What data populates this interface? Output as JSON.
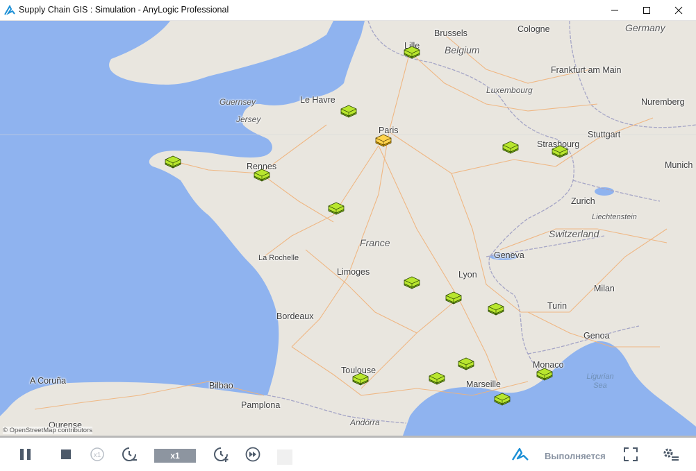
{
  "window": {
    "title": "Supply Chain GIS : Simulation - AnyLogic Professional",
    "app_icon": "anylogic-logo-icon",
    "controls": [
      "minimize-icon",
      "maximize-icon",
      "close-icon"
    ]
  },
  "map": {
    "attribution": "© OpenStreetMap contributors",
    "colors": {
      "land": "#e9e6df",
      "water": "#8fb3ef",
      "roads": "#f0b27a",
      "borders": "#a5a5c6"
    },
    "labels": [
      {
        "text": "Lille",
        "kind": "city"
      },
      {
        "text": "Brussels",
        "kind": "city"
      },
      {
        "text": "Cologne",
        "kind": "city"
      },
      {
        "text": "Germany",
        "kind": "country"
      },
      {
        "text": "Belgium",
        "kind": "country"
      },
      {
        "text": "Frankfurt am Main",
        "kind": "city"
      },
      {
        "text": "Luxembourg",
        "kind": "country"
      },
      {
        "text": "Nuremberg",
        "kind": "city"
      },
      {
        "text": "Le Havre",
        "kind": "city"
      },
      {
        "text": "Guernsey",
        "kind": "region"
      },
      {
        "text": "Jersey",
        "kind": "region"
      },
      {
        "text": "Paris",
        "kind": "city"
      },
      {
        "text": "Strasbourg",
        "kind": "city"
      },
      {
        "text": "Stuttgart",
        "kind": "city"
      },
      {
        "text": "Munich",
        "kind": "city"
      },
      {
        "text": "Rennes",
        "kind": "city"
      },
      {
        "text": "Zurich",
        "kind": "city"
      },
      {
        "text": "Liechtenstein",
        "kind": "region"
      },
      {
        "text": "Switzerland",
        "kind": "country"
      },
      {
        "text": "France",
        "kind": "country"
      },
      {
        "text": "La Rochelle",
        "kind": "city"
      },
      {
        "text": "Geneva",
        "kind": "city"
      },
      {
        "text": "Limoges",
        "kind": "city"
      },
      {
        "text": "Lyon",
        "kind": "city"
      },
      {
        "text": "Milan",
        "kind": "city"
      },
      {
        "text": "Bordeaux",
        "kind": "city"
      },
      {
        "text": "Turin",
        "kind": "city"
      },
      {
        "text": "Genoa",
        "kind": "city"
      },
      {
        "text": "Toulouse",
        "kind": "city"
      },
      {
        "text": "Monaco",
        "kind": "city"
      },
      {
        "text": "A Coruña",
        "kind": "city"
      },
      {
        "text": "Bilbao",
        "kind": "city"
      },
      {
        "text": "Marseille",
        "kind": "city"
      },
      {
        "text": "Ligurian Sea",
        "kind": "sea"
      },
      {
        "text": "Pamplona",
        "kind": "city"
      },
      {
        "text": "Ourense",
        "kind": "city"
      },
      {
        "text": "Andorra",
        "kind": "region"
      }
    ],
    "markers": [
      {
        "name": "warehouse-marker-lille",
        "color": "green"
      },
      {
        "name": "warehouse-marker-le-havre",
        "color": "green"
      },
      {
        "name": "warehouse-marker-paris",
        "color": "yellow"
      },
      {
        "name": "warehouse-marker-brest",
        "color": "green"
      },
      {
        "name": "warehouse-marker-rennes",
        "color": "green"
      },
      {
        "name": "warehouse-marker-metz",
        "color": "green"
      },
      {
        "name": "warehouse-marker-strasbourg",
        "color": "green"
      },
      {
        "name": "warehouse-marker-tours",
        "color": "green"
      },
      {
        "name": "warehouse-marker-clermont",
        "color": "green"
      },
      {
        "name": "warehouse-marker-lyon",
        "color": "green"
      },
      {
        "name": "warehouse-marker-grenoble",
        "color": "green"
      },
      {
        "name": "warehouse-marker-nimes",
        "color": "green"
      },
      {
        "name": "warehouse-marker-toulouse",
        "color": "green"
      },
      {
        "name": "warehouse-marker-montpellier",
        "color": "green"
      },
      {
        "name": "warehouse-marker-nice",
        "color": "green"
      },
      {
        "name": "warehouse-marker-marseille",
        "color": "green"
      }
    ],
    "marker_colors": {
      "green": [
        "#b8e62e",
        "#7fb31a",
        "#2f4a05"
      ],
      "yellow": [
        "#ffd34d",
        "#e0a800",
        "#5a4200"
      ]
    }
  },
  "toolbar": {
    "buttons": [
      "pause-icon",
      "stop-icon",
      "reset-speed-icon",
      "slow-down-icon",
      "speed-up-icon",
      "fast-forward-icon"
    ],
    "speed_label": "x1",
    "status_text": "Выполняется",
    "status_logo": "anylogic-logo-icon",
    "fullscreen_icon": "fullscreen-icon",
    "settings_icon": "settings-icon"
  }
}
